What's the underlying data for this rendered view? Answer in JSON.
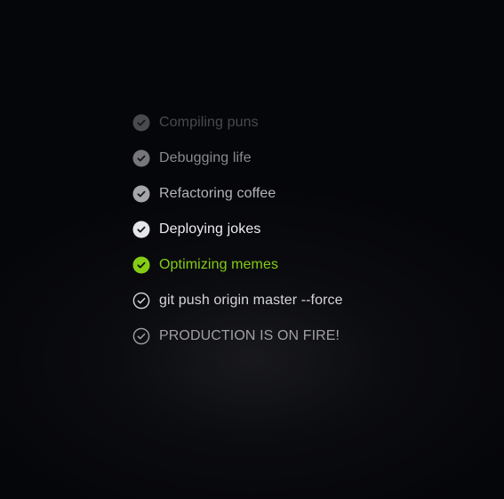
{
  "tasks": [
    {
      "label": "Compiling puns",
      "state": "done",
      "icon": "check-circle-filled-icon",
      "text_color": "#4a4a4e",
      "icon_fill": "#4a4a4e",
      "check_color": "#15161a"
    },
    {
      "label": "Debugging life",
      "state": "done",
      "icon": "check-circle-filled-icon",
      "text_color": "#8a8a8e",
      "icon_fill": "#77777b",
      "check_color": "#15161a"
    },
    {
      "label": "Refactoring coffee",
      "state": "done",
      "icon": "check-circle-filled-icon",
      "text_color": "#b4b4b8",
      "icon_fill": "#a6a6aa",
      "check_color": "#15161a"
    },
    {
      "label": "Deploying jokes",
      "state": "done",
      "icon": "check-circle-filled-icon",
      "text_color": "#ececee",
      "icon_fill": "#e6e6e8",
      "check_color": "#15161a"
    },
    {
      "label": "Optimizing memes",
      "state": "active",
      "icon": "check-circle-filled-icon",
      "text_color": "#84cc16",
      "icon_fill": "#84cc16",
      "check_color": "#0b1004"
    },
    {
      "label": "git push origin master --force",
      "state": "pending",
      "icon": "check-circle-outline-icon",
      "text_color": "#d6d6d8",
      "icon_stroke": "#d6d6d8"
    },
    {
      "label": "PRODUCTION IS ON FIRE!",
      "state": "pending",
      "icon": "check-circle-outline-icon",
      "text_color": "#a0a0a4",
      "icon_stroke": "#a0a0a4"
    }
  ]
}
